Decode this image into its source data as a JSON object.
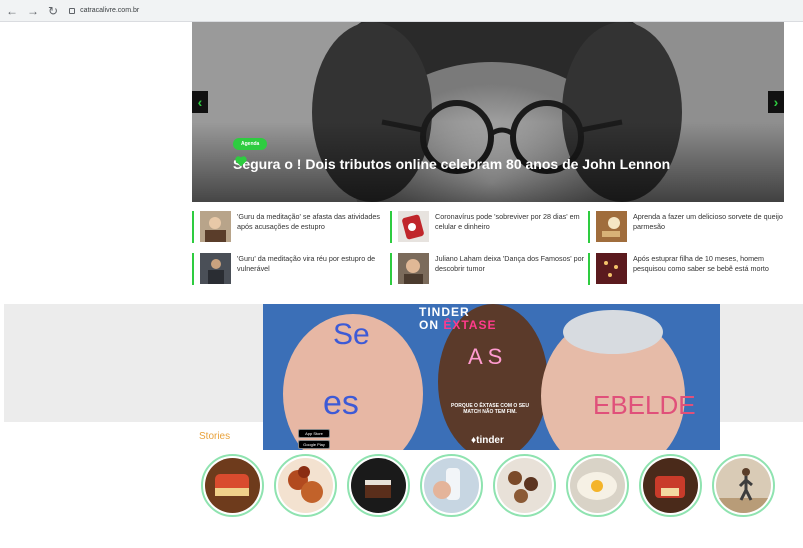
{
  "browser": {
    "url": "catracalivre.com.br"
  },
  "hero": {
    "badge": "Agenda",
    "title_before": "Segura o ",
    "title_after": "! Dois tributos online celebram 80 anos de John Lennon",
    "prev_label": "‹",
    "next_label": "›"
  },
  "news": [
    {
      "text": "'Guru da meditação' se afasta das atividades após acusações de estupro"
    },
    {
      "text": "Coronavírus pode 'sobreviver por 28 dias' em celular e dinheiro"
    },
    {
      "text": "Aprenda a fazer um delicioso sorvete de queijo parmesão"
    },
    {
      "text": "'Guru' da meditação vira réu por estupro de vulnerável"
    },
    {
      "text": "Juliano Laham deixa 'Dança dos Famosos' por descobrir tumor"
    },
    {
      "text": "Após estuprar filha de 10 meses, homem pesquisou como saber se bebê está morto"
    }
  ],
  "ad": {
    "line1": "TINDER",
    "line2_a": "ON ",
    "line2_b": "ÊXTASE",
    "copy": "PORQUE O ÊXTASE COM O SEU MATCH NÃO TEM FIM.",
    "brand": "tinder",
    "app_store": "App Store",
    "google_play": "Google Play"
  },
  "stories": {
    "title": "Stories",
    "count": 8
  },
  "colors": {
    "accent": "#2ecc40",
    "stories_title": "#e9a23b",
    "ad_bg": "#3b6fb7"
  }
}
